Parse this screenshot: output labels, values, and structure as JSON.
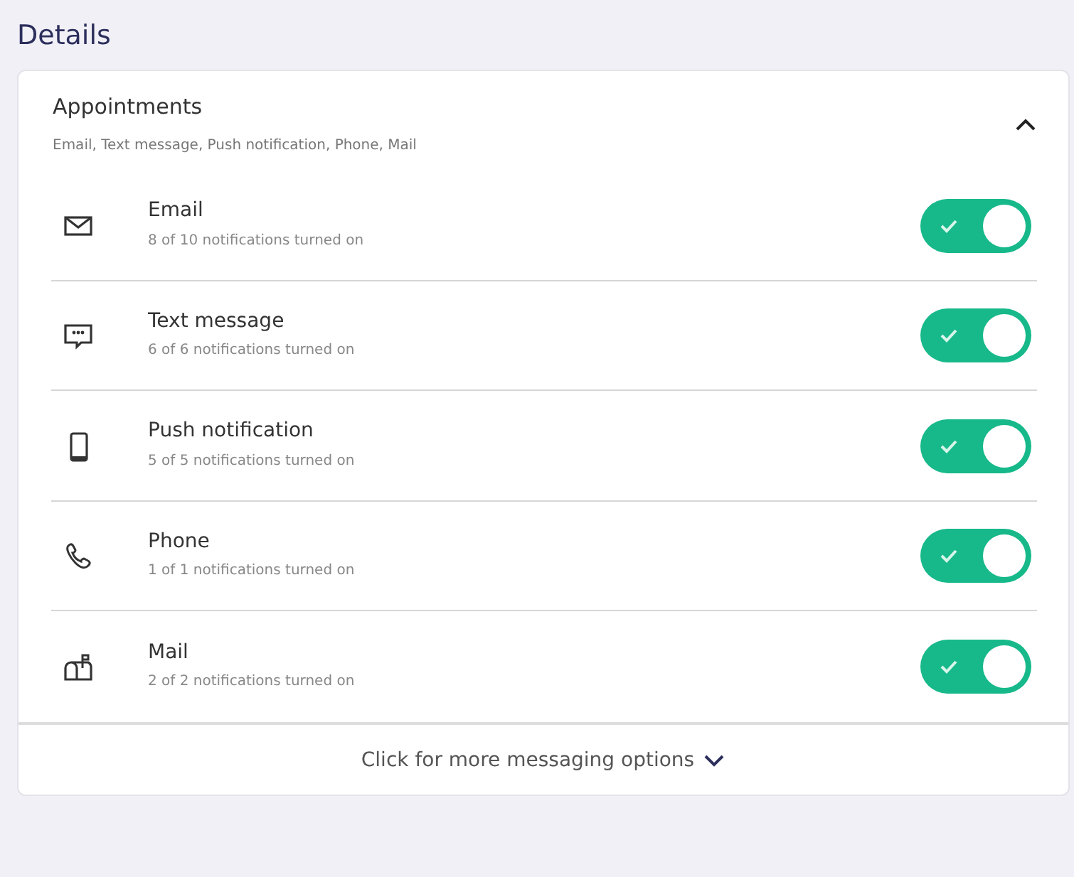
{
  "heading": "Details",
  "section": {
    "title": "Appointments",
    "summary": "Email, Text message, Push notification, Phone, Mail",
    "expanded": true,
    "channels": [
      {
        "name": "Email",
        "status": "8 of 10 notifications turned on",
        "on": true
      },
      {
        "name": "Text message",
        "status": "6 of 6 notifications turned on",
        "on": true
      },
      {
        "name": "Push notification",
        "status": "5 of 5 notifications turned on",
        "on": true
      },
      {
        "name": "Phone",
        "status": "1 of 1 notifications turned on",
        "on": true
      },
      {
        "name": "Mail",
        "status": "2 of 2 notifications turned on",
        "on": true
      }
    ],
    "more_link": "Click for more messaging options"
  }
}
